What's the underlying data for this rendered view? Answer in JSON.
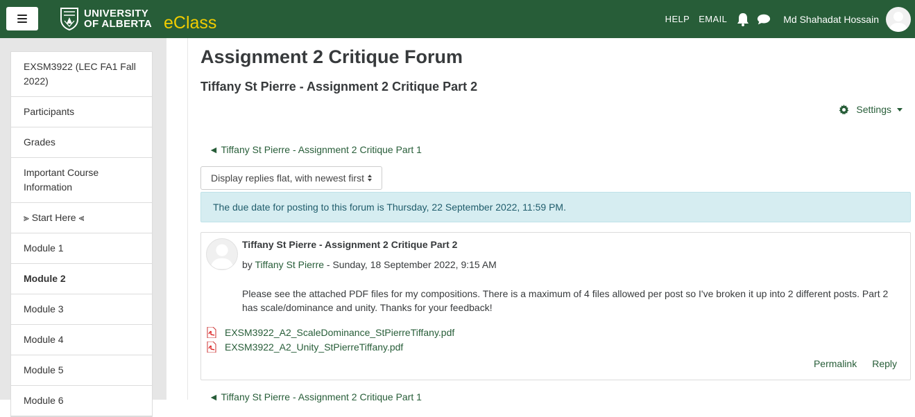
{
  "header": {
    "university_line1": "UNIVERSITY",
    "university_line2": "OF ALBERTA",
    "app_name": "eClass",
    "links": [
      "HELP",
      "EMAIL"
    ],
    "user_name": "Md Shahadat Hossain",
    "brand_color": "#275d38",
    "accent_color": "#f2cd00",
    "icons": [
      "menu-icon",
      "bell-icon",
      "chat-bubble-icon",
      "user-avatar-icon"
    ]
  },
  "sidebar": {
    "items": [
      {
        "label": "EXSM3922 (LEC FA1 Fall 2022)"
      },
      {
        "label": "Participants"
      },
      {
        "label": "Grades"
      },
      {
        "label": "Important Course Information"
      },
      {
        "label": "⫸ Start Here ⫷"
      },
      {
        "label": "Module 1"
      },
      {
        "label": "Module 2"
      },
      {
        "label": "Module 3"
      },
      {
        "label": "Module 4"
      },
      {
        "label": "Module 5"
      },
      {
        "label": "Module 6"
      }
    ]
  },
  "main": {
    "forum_title": "Assignment 2 Critique Forum",
    "discussion_title": "Tiffany St Pierre - Assignment 2 Critique Part 2",
    "settings_label": "Settings",
    "prev_discussion": "◄ Tiffany St Pierre - Assignment 2 Critique Part 1",
    "display_mode": "Display replies flat, with newest first",
    "due_notice": "The due date for posting to this forum is Thursday, 22 September 2022, 11:59 PM.",
    "post": {
      "subject": "Tiffany St Pierre - Assignment 2 Critique Part 2",
      "by_prefix": "by ",
      "author": "Tiffany St Pierre",
      "date": " - Sunday, 18 September 2022, 9:15 AM",
      "body": "Please see the attached PDF files for my compositions. There is a maximum of 4 files allowed per post so I've broken  it up into 2 different posts. Part 2 has scale/dominance and unity. Thanks for your feedback!",
      "attachments": [
        "EXSM3922_A2_ScaleDominance_StPierreTiffany.pdf",
        "EXSM3922_A2_Unity_StPierreTiffany.pdf"
      ],
      "permalink_label": "Permalink",
      "reply_label": "Reply"
    },
    "prev_discussion_bottom": "◄ Tiffany St Pierre - Assignment 2 Critique Part 1"
  }
}
